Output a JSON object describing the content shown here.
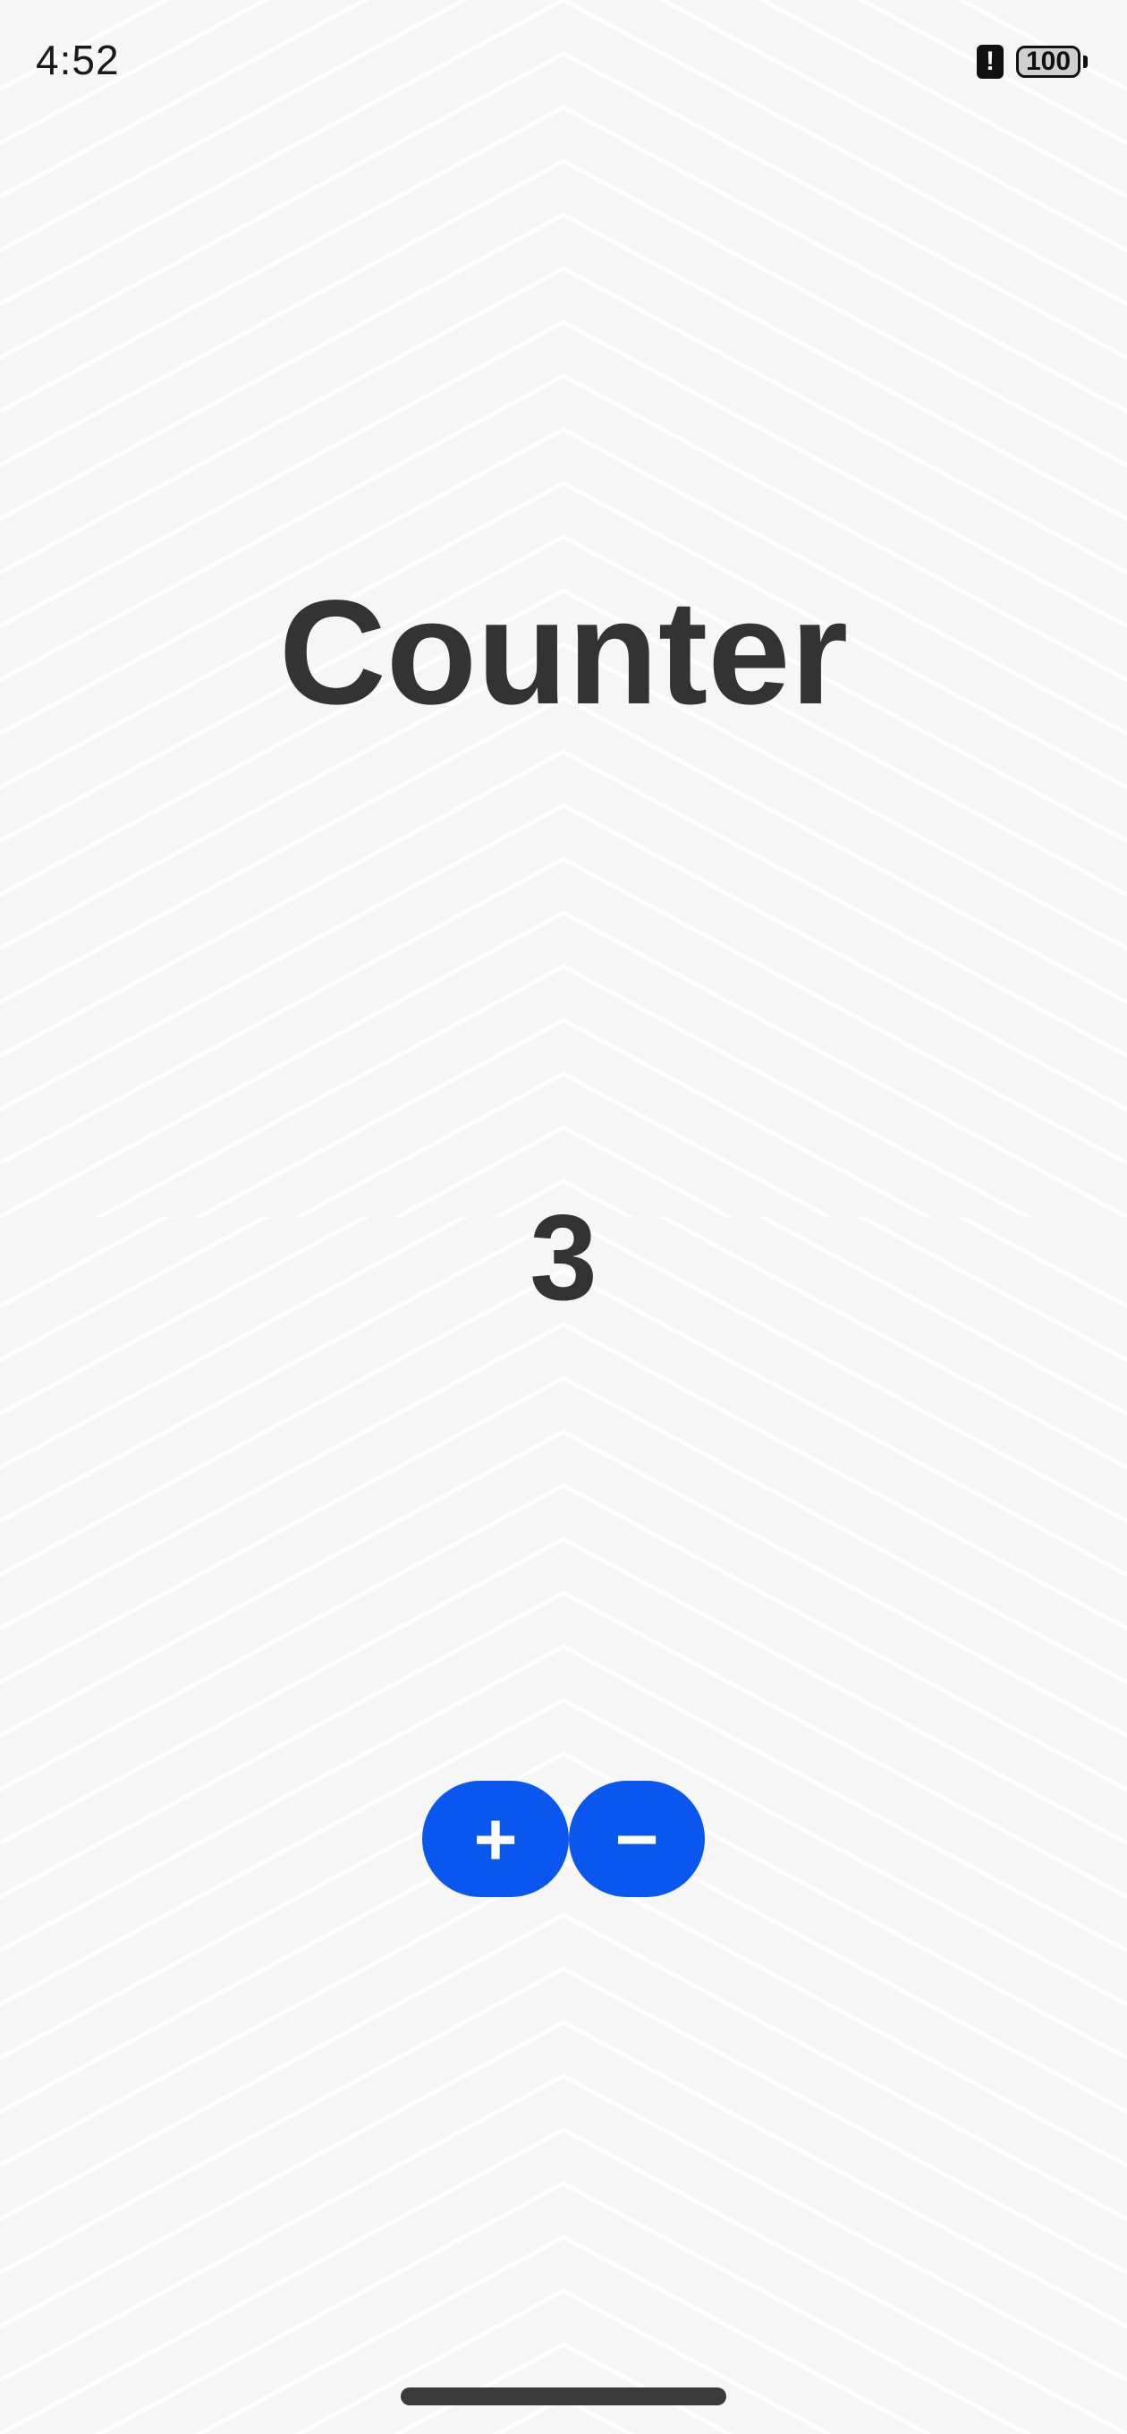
{
  "status_bar": {
    "time": "4:52",
    "battery_level": "100",
    "alert_icon": "alert-icon"
  },
  "main": {
    "title": "Counter",
    "count": "3"
  },
  "controls": {
    "increment_label": "+",
    "decrement_label": "−"
  },
  "colors": {
    "background": "#f6f6f6",
    "text": "#333333",
    "accent": "#0a57f0"
  }
}
